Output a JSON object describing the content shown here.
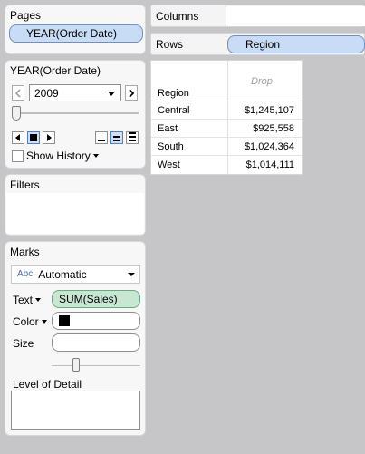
{
  "pages": {
    "title": "Pages",
    "pill": "YEAR(Order Date)"
  },
  "page_filter": {
    "title": "YEAR(Order Date)",
    "selected_year": "2009",
    "slider_fraction": 0.0,
    "show_history_label": "Show History"
  },
  "filters": {
    "title": "Filters"
  },
  "marks": {
    "title": "Marks",
    "mark_type_icon": "Abc",
    "mark_type": "Automatic",
    "text_label": "Text",
    "text_pill": "SUM(Sales)",
    "color_label": "Color",
    "color_swatch": "#000000",
    "size_label": "Size",
    "size_fraction": 0.25,
    "lod_label": "Level of Detail"
  },
  "shelves": {
    "columns_label": "Columns",
    "rows_label": "Rows",
    "rows_pill": "Region"
  },
  "table": {
    "row_header": "Region",
    "column_placeholder": "Drop",
    "rows": [
      {
        "region": "Central",
        "value": "$1,245,107"
      },
      {
        "region": "East",
        "value": "$925,558"
      },
      {
        "region": "South",
        "value": "$1,024,364"
      },
      {
        "region": "West",
        "value": "$1,014,111"
      }
    ]
  },
  "colors": {
    "blue_pill": "#c9dcf5",
    "green_pill": "#c8e7d3",
    "background": "#c6c6c8"
  }
}
